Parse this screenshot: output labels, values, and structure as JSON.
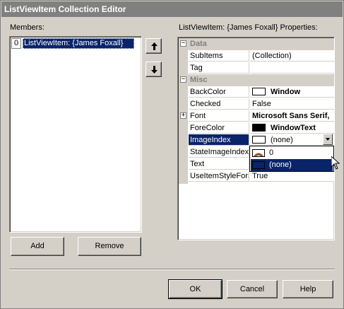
{
  "window": {
    "title": "ListViewItem Collection Editor"
  },
  "members": {
    "label": "Members:",
    "items": [
      {
        "index": "0",
        "label": "ListViewItem: {James Foxall}"
      }
    ],
    "add_label": "Add",
    "remove_label": "Remove"
  },
  "properties": {
    "label": "ListViewItem: {James Foxall} Properties:",
    "categories": [
      {
        "name": "Data",
        "expander": "⊟",
        "rows": [
          {
            "name": "SubItems",
            "value": "(Collection)"
          },
          {
            "name": "Tag",
            "value": ""
          }
        ]
      },
      {
        "name": "Misc",
        "expander": "⊟",
        "rows": [
          {
            "name": "BackColor",
            "value": "Window",
            "swatch": "#ffffff",
            "bold": true
          },
          {
            "name": "Checked",
            "value": "False"
          },
          {
            "name": "Font",
            "value": "Microsoft Sans Serif,",
            "bold": true,
            "expander": "+"
          },
          {
            "name": "ForeColor",
            "value": "WindowText",
            "swatch": "#000000",
            "bold": true
          },
          {
            "name": "ImageIndex",
            "value": "(none)",
            "swatch": "#ffffff",
            "selected": true
          },
          {
            "name": "StateImageIndex",
            "value": ""
          },
          {
            "name": "Text",
            "value": ""
          },
          {
            "name": "UseItemStyleForSubItems",
            "value": "True"
          }
        ]
      }
    ],
    "dropdown_options": [
      {
        "label": "0",
        "selected": false
      },
      {
        "label": "(none)",
        "selected": true
      }
    ]
  },
  "buttons": {
    "ok": "OK",
    "cancel": "Cancel",
    "help": "Help"
  },
  "colors": {
    "selection": "#0a246a",
    "face": "#d4d0c8",
    "title_bg": "#808080"
  }
}
